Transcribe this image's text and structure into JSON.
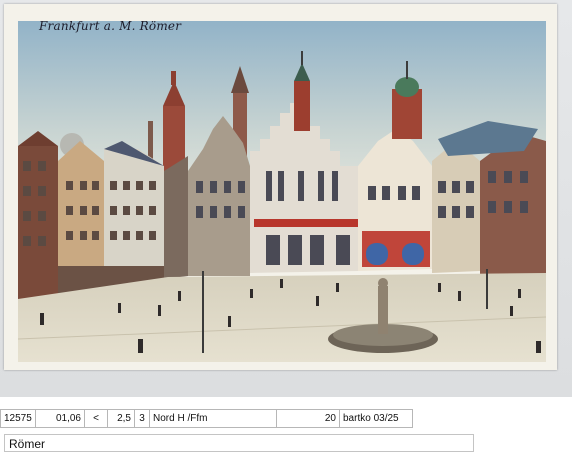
{
  "postcard": {
    "caption": "Frankfurt a. M. Römer"
  },
  "record": {
    "id": "12575",
    "price": "01,06",
    "comparator": "<",
    "grade": "2,5",
    "count": "3",
    "location_code": "Nord H /Ffm",
    "quantity": "20",
    "seller_ref": "bartko 03/25",
    "title": "Römer"
  },
  "colors": {
    "sky_top": "#97b7cb",
    "sky_bottom": "#e9ece2",
    "square": "#ddd8c6",
    "roofs": "#8d4a33",
    "facade_blue": "#3f66a6"
  }
}
